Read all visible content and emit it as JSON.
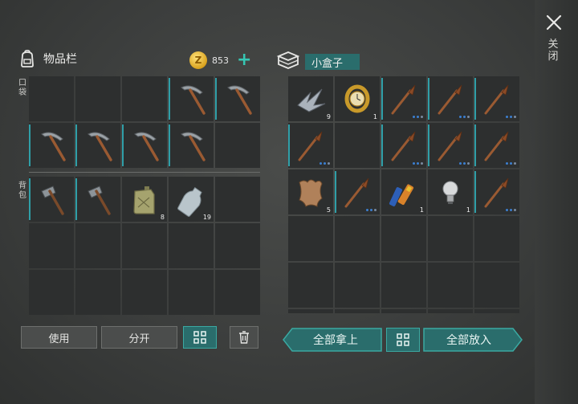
{
  "close": {
    "label": "关闭"
  },
  "inventory": {
    "title": "物品栏",
    "pocket_label": "口袋",
    "backpack_label": "背包",
    "money": "853",
    "pocket_slots": [
      {
        "item": "empty"
      },
      {
        "item": "empty"
      },
      {
        "item": "empty"
      },
      {
        "item": "pickaxe",
        "durability": true
      },
      {
        "item": "pickaxe",
        "durability": true
      },
      {
        "item": "pickaxe",
        "durability": true
      },
      {
        "item": "pickaxe",
        "durability": true
      },
      {
        "item": "pickaxe",
        "durability": true
      },
      {
        "item": "pickaxe",
        "durability": true
      },
      {
        "item": "empty"
      }
    ],
    "backpack_slots": [
      {
        "item": "hatchet",
        "durability": true
      },
      {
        "item": "hatchet",
        "durability": true
      },
      {
        "item": "jerrycan",
        "count": "8"
      },
      {
        "item": "water-bottle",
        "count": "19"
      },
      {
        "item": "empty"
      },
      {
        "item": "empty"
      },
      {
        "item": "empty"
      },
      {
        "item": "empty"
      },
      {
        "item": "empty"
      },
      {
        "item": "empty"
      },
      {
        "item": "empty"
      },
      {
        "item": "empty"
      },
      {
        "item": "empty"
      },
      {
        "item": "empty"
      },
      {
        "item": "empty"
      }
    ]
  },
  "container": {
    "name": "小盒子",
    "slots": [
      {
        "item": "scrap-metal",
        "count": "9"
      },
      {
        "item": "gold-watch",
        "count": "1"
      },
      {
        "item": "spear",
        "durability": true,
        "dots": true
      },
      {
        "item": "spear",
        "durability": true,
        "dots": true
      },
      {
        "item": "spear",
        "durability": true,
        "dots": true
      },
      {
        "item": "spear",
        "durability": true,
        "dots": true
      },
      {
        "item": "empty"
      },
      {
        "item": "spear",
        "durability": true,
        "dots": true
      },
      {
        "item": "spear",
        "durability": true,
        "dots": true
      },
      {
        "item": "spear",
        "durability": true,
        "dots": true
      },
      {
        "item": "leather",
        "count": "5"
      },
      {
        "item": "spear",
        "durability": true,
        "dots": true
      },
      {
        "item": "batteries",
        "count": "1"
      },
      {
        "item": "light-bulb",
        "count": "1"
      },
      {
        "item": "spear",
        "durability": true,
        "dots": true
      },
      {
        "item": "empty"
      },
      {
        "item": "empty"
      },
      {
        "item": "empty"
      },
      {
        "item": "empty"
      },
      {
        "item": "empty"
      },
      {
        "item": "empty"
      },
      {
        "item": "empty"
      },
      {
        "item": "empty"
      },
      {
        "item": "empty"
      },
      {
        "item": "empty"
      },
      {
        "item": "empty"
      },
      {
        "item": "empty"
      },
      {
        "item": "empty"
      },
      {
        "item": "empty"
      },
      {
        "item": "empty"
      }
    ]
  },
  "buttons": {
    "use": "使用",
    "split": "分开",
    "take_all": "全部拿上",
    "put_all": "全部放入"
  },
  "colors": {
    "accent": "#2a6d6c",
    "accent_border": "#3aa9a2",
    "plus": "#36c7b4",
    "durability": "#2f9fa8"
  }
}
